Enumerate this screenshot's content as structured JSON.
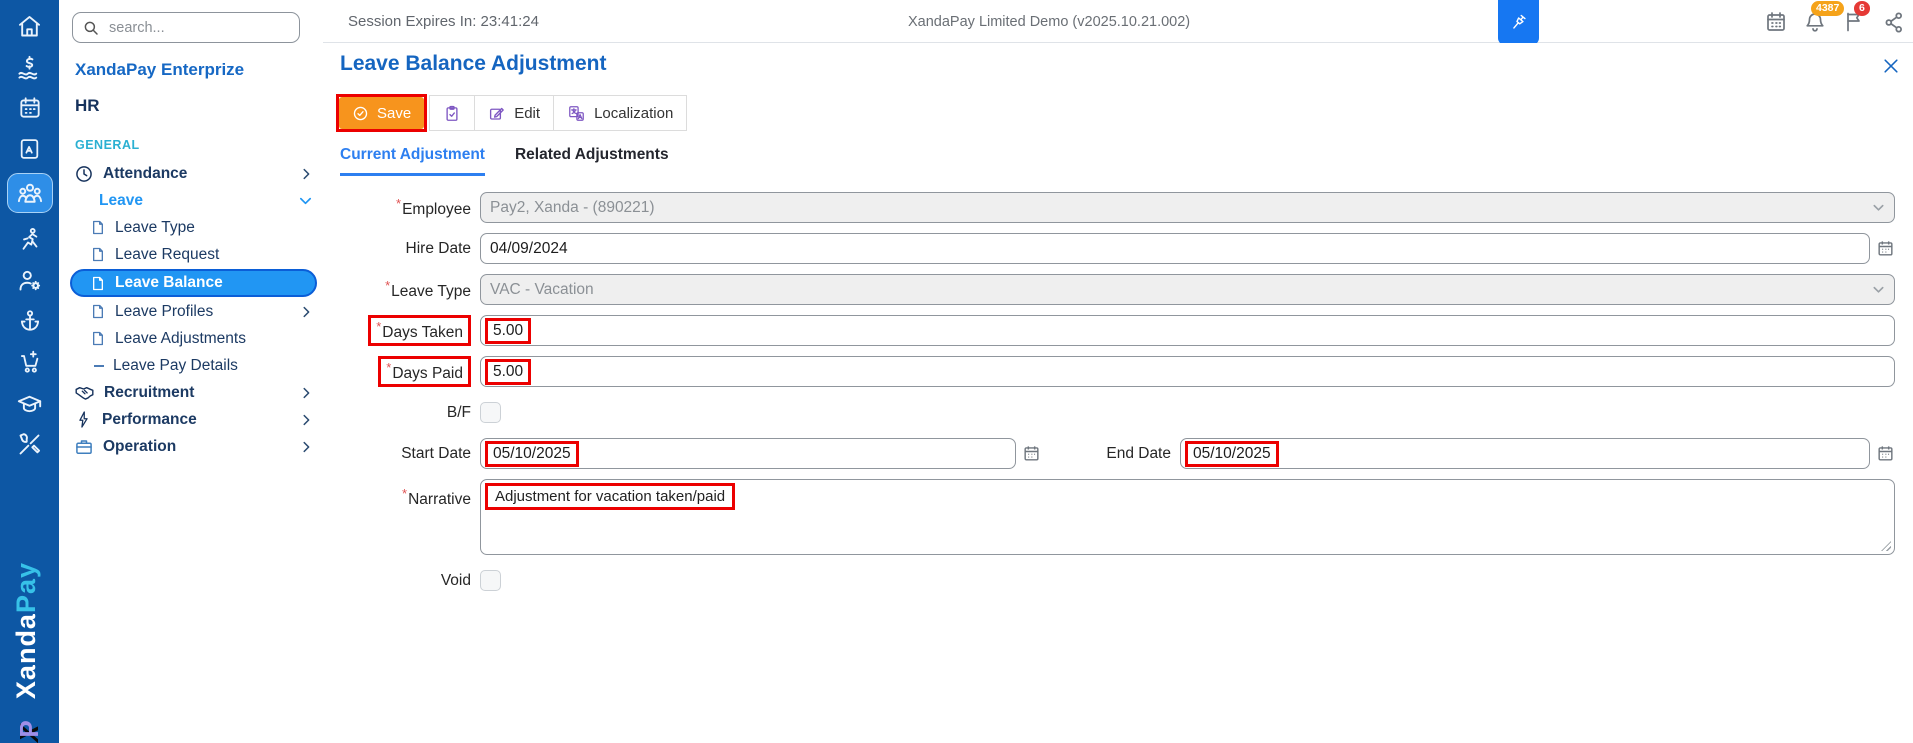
{
  "colors": {
    "rail_blue": "#0d57a4",
    "accent_blue": "#2196f3",
    "title_blue": "#1565c0",
    "save_orange": "#f7941d",
    "annotation_red": "#ec0000",
    "badge_orange": "#f5a31a",
    "badge_red": "#e53935",
    "section_teal": "#2bb0d2"
  },
  "topbar": {
    "session": "Session Expires In: 23:41:24",
    "app_title": "XandaPay Limited Demo (v2025.10.21.002)",
    "bell_badge": "4387",
    "flag_badge": "6"
  },
  "sidebar": {
    "search_placeholder": "search...",
    "company": "XandaPay Enterprize",
    "module": "HR",
    "section": "GENERAL",
    "items": [
      {
        "label": "Attendance"
      },
      {
        "label": "Leave"
      },
      {
        "label": "Leave Type"
      },
      {
        "label": "Leave Request"
      },
      {
        "label": "Leave Balance"
      },
      {
        "label": "Leave Profiles"
      },
      {
        "label": "Leave Adjustments"
      },
      {
        "label": "Leave Pay Details"
      },
      {
        "label": "Recruitment"
      },
      {
        "label": "Performance"
      },
      {
        "label": "Operation"
      }
    ],
    "brand_bottom": "Xanda",
    "brand_top": "Pay"
  },
  "page": {
    "title": "Leave Balance Adjustment",
    "toolbar": {
      "save": "Save",
      "edit": "Edit",
      "localization": "Localization"
    },
    "tabs": [
      {
        "label": "Current Adjustment"
      },
      {
        "label": "Related Adjustments"
      }
    ],
    "form": {
      "employee_label": "Employee",
      "employee_value": "Pay2, Xanda - (890221)",
      "hire_date_label": "Hire Date",
      "hire_date_value": "04/09/2024",
      "leave_type_label": "Leave Type",
      "leave_type_value": "VAC - Vacation",
      "days_taken_label": "Days Taken",
      "days_taken_value": "5.00",
      "days_paid_label": "Days Paid",
      "days_paid_value": "5.00",
      "bf_label": "B/F",
      "start_date_label": "Start Date",
      "start_date_value": "05/10/2025",
      "end_date_label": "End Date",
      "end_date_value": "05/10/2025",
      "narrative_label": "Narrative",
      "narrative_value": "Adjustment for vacation taken/paid",
      "void_label": "Void"
    }
  }
}
